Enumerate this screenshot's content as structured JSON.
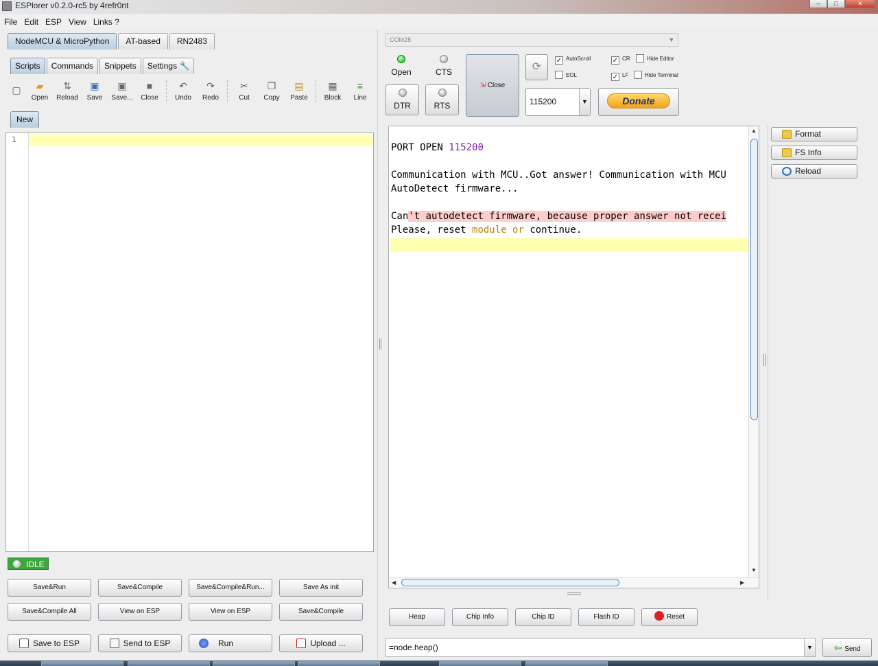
{
  "window": {
    "title": "ESPlorer v0.2.0-rc5 by 4refr0nt"
  },
  "menubar": [
    "File",
    "Edit",
    "ESP",
    "View",
    "Links ?"
  ],
  "top_tabs": [
    "NodeMCU & MicroPython",
    "AT-based",
    "RN2483"
  ],
  "sub_tabs": [
    "Scripts",
    "Commands",
    "Snippets",
    "Settings"
  ],
  "toolbar": {
    "items": [
      "Open",
      "Reload",
      "Save",
      "Save...",
      "Close",
      "Undo",
      "Redo",
      "Cut",
      "Copy",
      "Paste",
      "Block",
      "Line"
    ]
  },
  "file_tab": "New",
  "editor": {
    "line_number": "1"
  },
  "status": {
    "idle": "IDLE"
  },
  "script_buttons": {
    "row1": [
      "Save&Run",
      "Save&Compile",
      "Save&Compile&Run...",
      "Save As init"
    ],
    "row2": [
      "Save&Compile All",
      "View on ESP",
      "View on ESP",
      "Save&Compile"
    ],
    "row3": [
      "Save to ESP",
      "Send to ESP",
      "Run",
      "Upload ..."
    ]
  },
  "port": {
    "combo": "COM28",
    "open": "Open",
    "cts": "CTS",
    "dtr": "DTR",
    "rts": "RTS",
    "close": "Close",
    "baud": "115200",
    "donate": "Donate"
  },
  "checkboxes": {
    "autoscroll": "AutoScroll",
    "eol": "EOL",
    "cr": "CR",
    "lf": "LF",
    "hide_editor": "Hide Editor",
    "hide_terminal": "Hide Terminal"
  },
  "terminal": {
    "port_open": "PORT OPEN",
    "port_baud": "115200",
    "comm": "Communication with MCU..Got answer! Communication with MCU",
    "autodetect": "AutoDetect firmware...",
    "cant_pre": "Can",
    "cant_warn": "'t autodetect firmware, because proper answer not recei",
    "please_pre": "Please, reset ",
    "please_kw1": "module",
    "please_mid": " ",
    "please_kw2": "or",
    "please_post": " continue."
  },
  "side_buttons": [
    "Format",
    "FS Info",
    "Reload"
  ],
  "bottom_buttons": [
    "Heap",
    "Chip Info",
    "Chip ID",
    "Flash ID",
    "Reset"
  ],
  "command": {
    "value": "=node.heap()",
    "send": "Send"
  },
  "colors": {
    "green": "#3ea83e",
    "highlight": "#ffffb0",
    "warn": "#ffcccc"
  }
}
